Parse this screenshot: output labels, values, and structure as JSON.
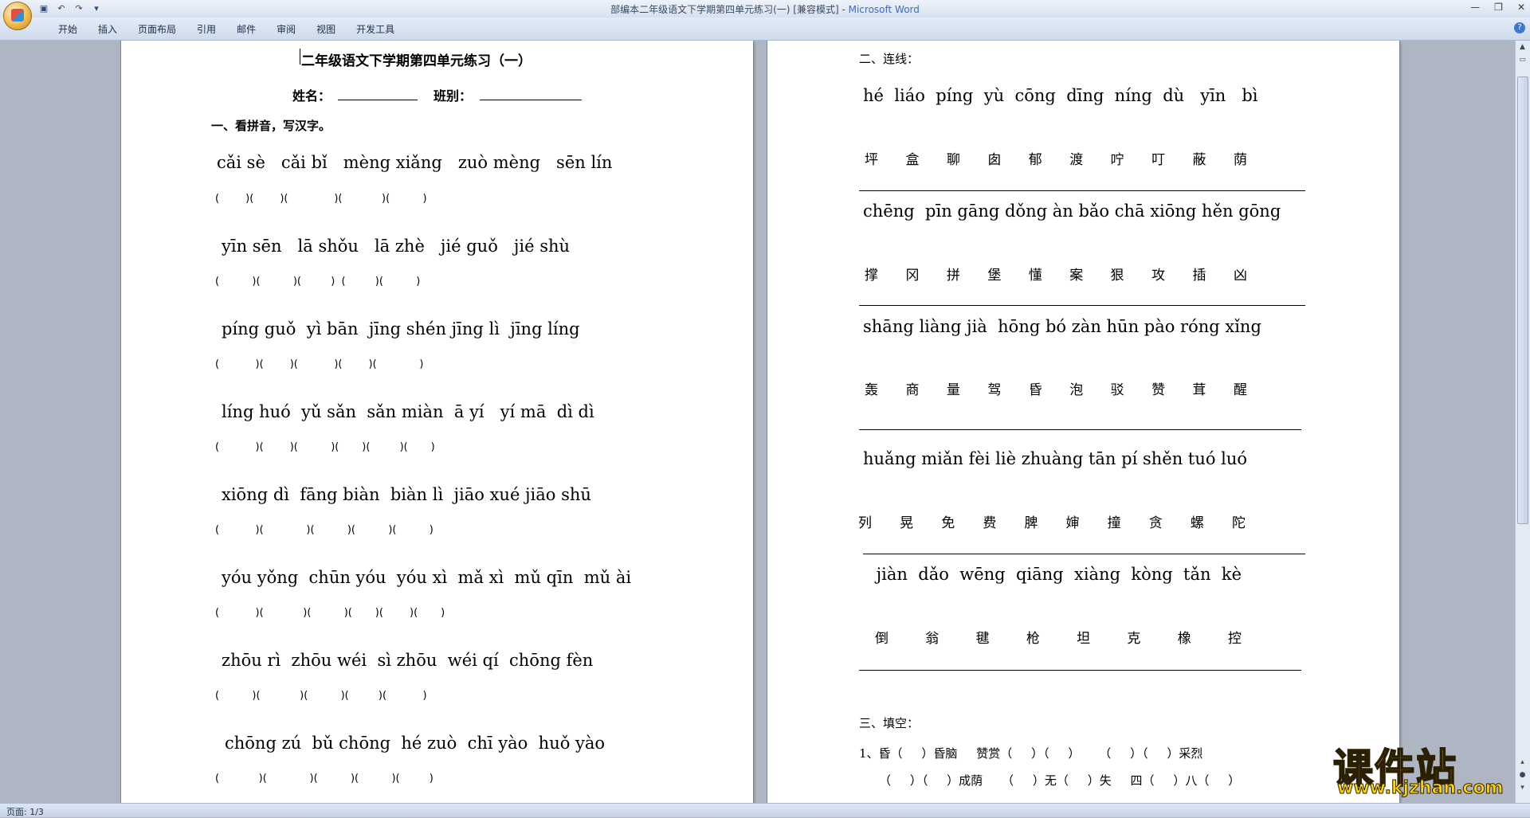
{
  "window": {
    "title_doc": "部编本二年级语文下学期第四单元练习(一) [兼容模式] - ",
    "title_app": "Microsoft Word"
  },
  "ribbon": {
    "tabs": [
      "开始",
      "插入",
      "页面布局",
      "引用",
      "邮件",
      "审阅",
      "视图",
      "开发工具"
    ]
  },
  "status": {
    "page": "页面: 1/3"
  },
  "page1": {
    "title": "二年级语文下学期第四单元练习（一）",
    "name_label": "姓名：",
    "class_label": "班别：",
    "section1": "一、看拼音，写汉字。",
    "pinyin_rows": [
      "cǎi sè   cǎi bǐ   mèng xiǎng   zuò mèng   sēn lín",
      "yīn sēn   lā shǒu   lā zhè   jié guǒ   jié shù",
      "píng guǒ  yì bān  jīng shén jīng lì  jīng líng",
      "líng huó  yǔ sǎn  sǎn miàn  ā yí   yí mā  dì dì",
      "xiōng dì  fāng biàn  biàn lì  jiāo xué jiāo shū",
      "yóu yǒng  chūn yóu  yóu xì  mǎ xì  mǔ qīn  mǔ ài",
      "zhōu rì  zhōu wéi  sì zhōu  wéi qí  chōng fèn",
      "chōng zú  bǔ chōng  hé zuò  chī yào  huǒ yào"
    ],
    "bracket_rows": [
      "(        )(        )(              )(            )(          )",
      "(          )(          )(         )  (         )(          )",
      "(           )(        )(           )(        )(             )",
      "(           )(        )(          )(       )(         )(       )",
      "(           )(             )(          )(          )(          )",
      "(           )(            )(          )(       )(        )(       )",
      "(          )(            )(          )(         )(           )",
      "(            )(             )(          )(          )(         )"
    ]
  },
  "page2": {
    "section2": "二、连线：",
    "groups": [
      {
        "pinyin": "hé  liáo  píng  yù  cōng  dīng  níng  dù   yīn   bì",
        "chars": [
          "坪",
          "盒",
          "聊",
          "囱",
          "郁",
          "渡",
          "咛",
          "叮",
          "蔽",
          "荫"
        ]
      },
      {
        "pinyin": "chēng  pīn gāng dǒng àn bǎo chā xiōng hěn gōng",
        "chars": [
          "撑",
          "冈",
          "拼",
          "堡",
          "懂",
          "案",
          "狠",
          "攻",
          "插",
          "凶"
        ]
      },
      {
        "pinyin": "shāng liàng jià  hōng bó zàn hūn pào róng xǐng",
        "chars": [
          "轰",
          "商",
          "量",
          "驾",
          "昏",
          "泡",
          "驳",
          "赞",
          "茸",
          "醒"
        ]
      },
      {
        "pinyin": "huǎng miǎn fèi liè zhuàng tān pí shěn tuó luó",
        "chars": [
          "列",
          "晃",
          "免",
          "费",
          "脾",
          "婶",
          "撞",
          "贪",
          "螺",
          "陀"
        ]
      },
      {
        "pinyin": " jiàn  dǎo  wēng  qiāng  xiàng  kòng  tǎn  kè",
        "chars": [
          "倒",
          "翁",
          "毽",
          "枪",
          "坦",
          "克",
          "橡",
          "控"
        ]
      }
    ],
    "section3": "三、填空：",
    "fill1": "1、昏（     ）昏脑     赞赏（     ）（     ）     （     ）（     ）采烈",
    "fill2": "（     ）（     ）成荫     （     ）无（     ）失     四（     ）八（     ）"
  },
  "watermark": {
    "cn": "课件站",
    "url": "www.kjzhan.com"
  }
}
